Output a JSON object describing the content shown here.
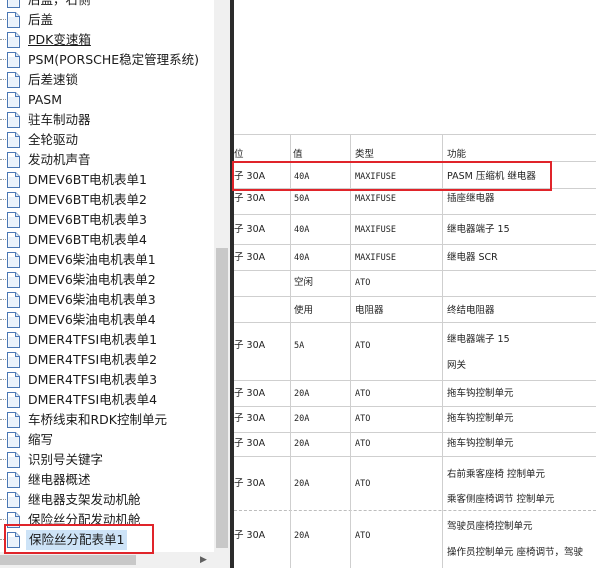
{
  "nav": {
    "items": [
      {
        "label": "后盖，右侧",
        "link": false
      },
      {
        "label": "后盖",
        "link": false
      },
      {
        "label": "PDK变速箱",
        "link": true
      },
      {
        "label": "PSM(PORSCHE稳定管理系统)",
        "link": false
      },
      {
        "label": "后差速锁",
        "link": false
      },
      {
        "label": "PASM",
        "link": false
      },
      {
        "label": "驻车制动器",
        "link": false
      },
      {
        "label": "全轮驱动",
        "link": false
      },
      {
        "label": "发动机声音",
        "link": false
      },
      {
        "label": "DMEV6BT电机表单1",
        "link": false
      },
      {
        "label": "DMEV6BT电机表单2",
        "link": false
      },
      {
        "label": "DMEV6BT电机表单3",
        "link": false
      },
      {
        "label": "DMEV6BT电机表单4",
        "link": false
      },
      {
        "label": "DMEV6柴油电机表单1",
        "link": false
      },
      {
        "label": "DMEV6柴油电机表单2",
        "link": false
      },
      {
        "label": "DMEV6柴油电机表单3",
        "link": false
      },
      {
        "label": "DMEV6柴油电机表单4",
        "link": false
      },
      {
        "label": "DMER4TFSI电机表单1",
        "link": false
      },
      {
        "label": "DMER4TFSI电机表单2",
        "link": false
      },
      {
        "label": "DMER4TFSI电机表单3",
        "link": false
      },
      {
        "label": "DMER4TFSI电机表单4",
        "link": false
      },
      {
        "label": "车桥线束和RDK控制单元",
        "link": false
      },
      {
        "label": "缩写",
        "link": false
      },
      {
        "label": "识别号关键字",
        "link": false
      },
      {
        "label": "继电器概述",
        "link": false
      },
      {
        "label": "继电器支架发动机舱",
        "link": false
      },
      {
        "label": "保险丝分配发动机舱",
        "link": false
      },
      {
        "label": "保险丝分配表单1",
        "link": false,
        "selected": true
      }
    ]
  },
  "table": {
    "headers": {
      "pos": "位",
      "value": "值",
      "type": "类型",
      "function": "功能"
    },
    "rows": [
      {
        "pos": "子 30A",
        "value": "40A",
        "type": "MAXIFUSE",
        "function": [
          "PASM 压缩机 继电器"
        ]
      },
      {
        "pos": "子 30A",
        "value": "50A",
        "type": "MAXIFUSE",
        "function": [
          "插座继电器"
        ]
      },
      {
        "pos": "子 30A",
        "value": "40A",
        "type": "MAXIFUSE",
        "function": [
          "继电器端子 15"
        ]
      },
      {
        "pos": "子 30A",
        "value": "40A",
        "type": "MAXIFUSE",
        "function": [
          "继电器 SCR"
        ]
      },
      {
        "pos": "",
        "value": "空闲",
        "type": "ATO",
        "function": [
          ""
        ]
      },
      {
        "pos": "",
        "value": "使用",
        "type": "电阻器",
        "function": [
          "终结电阻器"
        ]
      },
      {
        "pos": "子 30A",
        "value": "5A",
        "type": "ATO",
        "function": [
          "继电器端子 15",
          "网关"
        ]
      },
      {
        "pos": "子 30A",
        "value": "20A",
        "type": "ATO",
        "function": [
          "拖车钩控制单元"
        ]
      },
      {
        "pos": "子 30A",
        "value": "20A",
        "type": "ATO",
        "function": [
          "拖车钩控制单元"
        ]
      },
      {
        "pos": "子 30A",
        "value": "20A",
        "type": "ATO",
        "function": [
          "拖车钩控制单元"
        ]
      },
      {
        "pos": "子 30A",
        "value": "20A",
        "type": "ATO",
        "function": [
          "右前乘客座椅 控制单元",
          "乘客侧座椅调节 控制单元"
        ]
      },
      {
        "pos": "子 30A",
        "value": "20A",
        "type": "ATO",
        "function": [
          "驾驶员座椅控制单元",
          "操作员控制单元 座椅调节，驾驶"
        ]
      }
    ]
  },
  "colors": {
    "highlight": "#e0242a",
    "selection": "#cde3f7",
    "splitter": "#2b2b2b"
  },
  "icons": {
    "tree_item": "document-icon",
    "scroll_right": "chevron-right-icon"
  }
}
